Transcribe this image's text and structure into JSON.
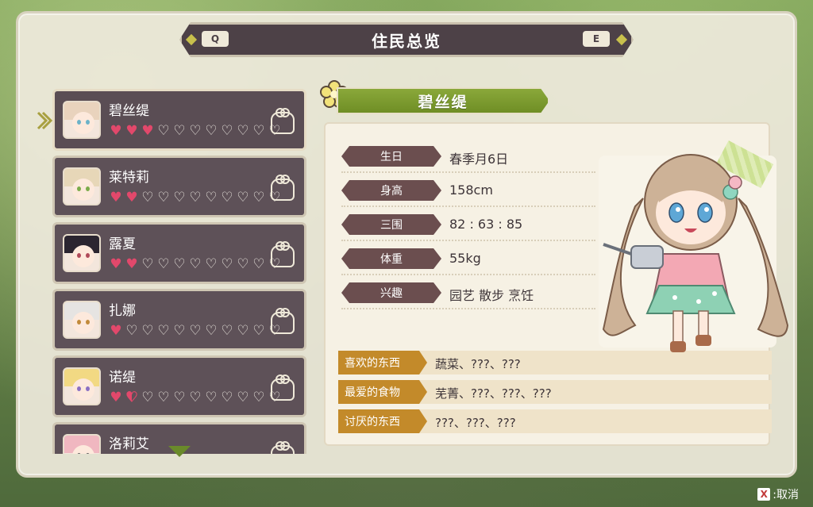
{
  "header": {
    "title": "住民总览",
    "prev_key": "Q",
    "next_key": "E"
  },
  "residents": [
    {
      "name": "碧丝缇",
      "hearts_filled": 3,
      "hearts_total": 11,
      "selected": true,
      "hair": "#e9d3bd",
      "eye": "#6cb2c8"
    },
    {
      "name": "莱特莉",
      "hearts_filled": 2,
      "hearts_total": 11,
      "selected": false,
      "hair": "#e7d7b8",
      "eye": "#7bab4a"
    },
    {
      "name": "露夏",
      "hearts_filled": 2,
      "hearts_total": 11,
      "selected": false,
      "hair": "#2b2530",
      "eye": "#b04a5a"
    },
    {
      "name": "扎娜",
      "hearts_filled": 1,
      "hearts_total": 11,
      "selected": false,
      "hair": "#e6e4e2",
      "eye": "#c28a3a"
    },
    {
      "name": "诺缇",
      "hearts_filled": 1.5,
      "hearts_total": 11,
      "selected": false,
      "hair": "#f2d983",
      "eye": "#8a6fc4"
    },
    {
      "name": "洛莉艾",
      "hearts_filled": 0,
      "hearts_total": 11,
      "selected": false,
      "hair": "#f0b7c0",
      "eye": "#5c5c5c"
    }
  ],
  "profile": {
    "name": "碧丝缇",
    "stats": [
      {
        "label": "生日",
        "value": "春季月6日"
      },
      {
        "label": "身高",
        "value": "158cm"
      },
      {
        "label": "三围",
        "value": "82 : 63 : 85"
      },
      {
        "label": "体重",
        "value": "55kg"
      },
      {
        "label": "兴趣",
        "value": "园艺 散步 烹饪"
      }
    ],
    "preferences": [
      {
        "label": "喜欢的东西",
        "value": "蔬菜、???、???"
      },
      {
        "label": "最爱的食物",
        "value": "芜菁、???、???、???"
      },
      {
        "label": "讨厌的东西",
        "value": "???、???、???"
      }
    ]
  },
  "footer": {
    "cancel_key": "X",
    "cancel_label": ":取消"
  },
  "colors": {
    "heart": "#e2486b",
    "accent_green": "#7a9a2e",
    "panel_dark": "#5e5158",
    "pref_label": "#c38a2a"
  }
}
